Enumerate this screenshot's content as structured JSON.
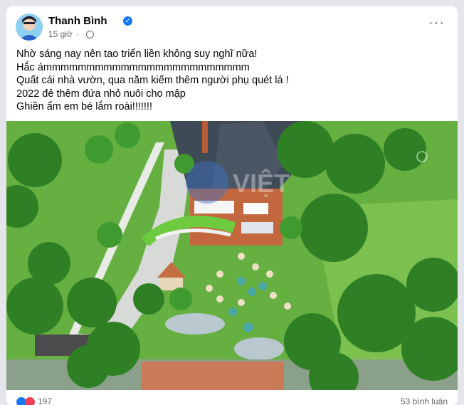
{
  "post": {
    "author": "Thanh Bình",
    "time": "15 giờ",
    "lines": [
      "Nhờ sáng nay nên tao triển liền không suy nghĩ nữa!",
      "Hắc ámmmmmmmmmmmmmmmmmmmmmmmm",
      "Quất cái nhà vườn, qua năm kiếm thêm người phụ quét lá !",
      "2022 đẻ thêm đứa nhỏ nuôi cho mập",
      "Ghiền ẩm em bé lắm roài!!!!!!!"
    ],
    "watermark": "VIỆT",
    "reaction_count": "197",
    "comments": "53 bình luận"
  },
  "icons": {
    "verified": "verified-badge-icon",
    "privacy": "globe-icon",
    "more": "more-options-icon"
  },
  "colors": {
    "accent": "#1877f2",
    "secondary_text": "#65676b"
  }
}
